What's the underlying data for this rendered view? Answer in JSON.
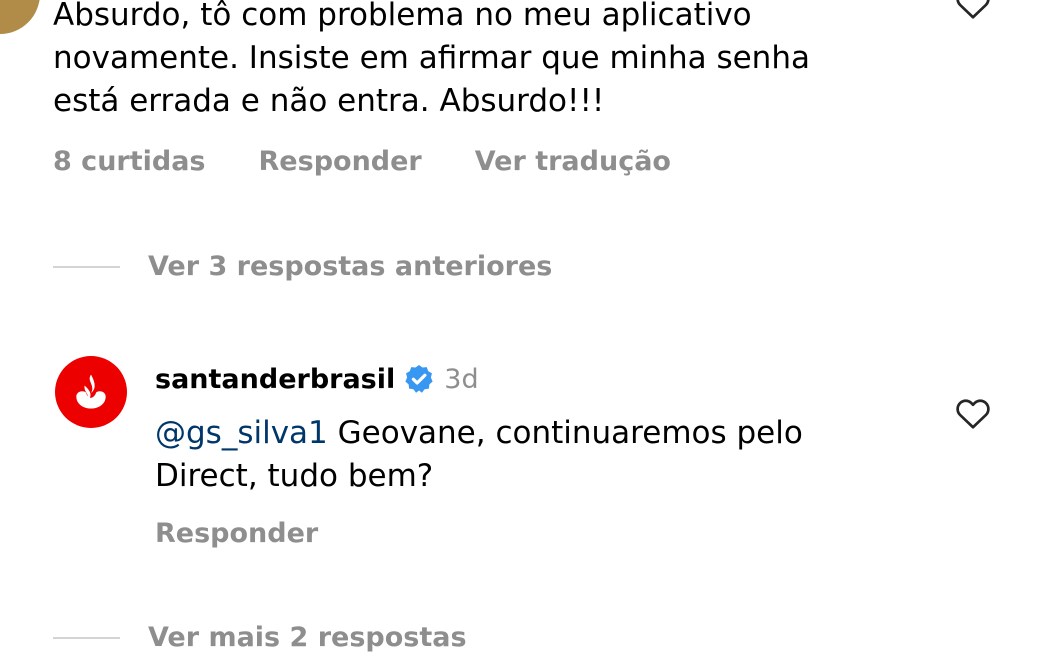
{
  "main_comment": {
    "text": "Absurdo, tô com problema no meu aplicativo\nnovamente. Insiste em afirmar que minha senha\nestá errada e não entra. Absurdo!!!",
    "likes": "8 curtidas",
    "reply_label": "Responder",
    "translate_label": "Ver tradução",
    "like_icon": "heart-outline-icon"
  },
  "previous_replies": {
    "label": "Ver 3 respostas anteriores"
  },
  "brand_reply": {
    "username": "santanderbrasil",
    "verified_icon": "verified-badge-icon",
    "time": "3d",
    "mention": "@gs_silva1",
    "text": " Geovane, continuaremos pelo Direct, tudo bem?",
    "reply_label": "Responder",
    "avatar_color": "#ec0000",
    "verified_color": "#3897f0"
  },
  "more_replies": {
    "label": "Ver mais 2 respostas"
  }
}
